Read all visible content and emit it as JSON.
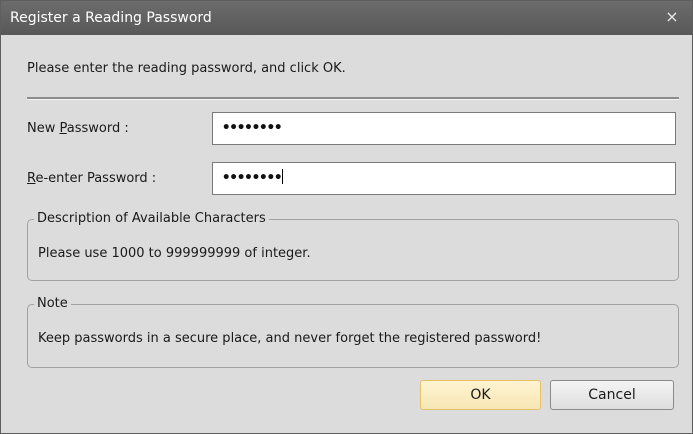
{
  "dialog": {
    "title": "Register a Reading Password",
    "close_glyph": "×",
    "instruction": "Please enter the reading password, and click OK."
  },
  "fields": {
    "new_password": {
      "label": "New Password :",
      "mnemonic": "P",
      "value_masked": "••••••••"
    },
    "reenter_password": {
      "label": "Re-enter Password :",
      "mnemonic": "R",
      "value_masked": "••••••••"
    }
  },
  "description_group": {
    "legend": "Description of Available Characters",
    "text": "Please use 1000 to 999999999 of integer."
  },
  "note_group": {
    "legend": "Note",
    "text": "Keep passwords in a secure place, and never forget the registered password!"
  },
  "buttons": {
    "ok": "OK",
    "cancel": "Cancel"
  },
  "icons": {
    "close": "close-icon"
  },
  "colors": {
    "titlebar": "#626262",
    "dialog_bg": "#dcdcdc",
    "ok_highlight": "#f7e6b4"
  }
}
